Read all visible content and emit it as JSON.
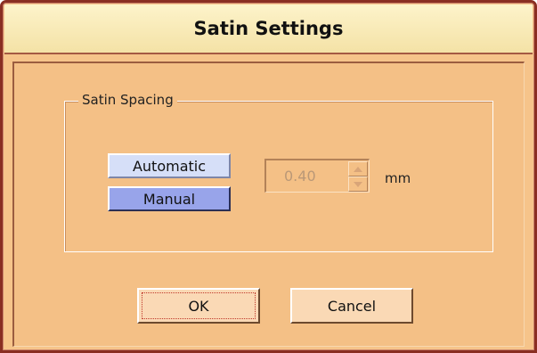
{
  "window": {
    "title": "Satin Settings"
  },
  "group": {
    "label": "Satin Spacing"
  },
  "mode_buttons": {
    "automatic": "Automatic",
    "manual": "Manual",
    "selected": "Manual"
  },
  "spacing": {
    "value": "0.40",
    "unit": "mm",
    "enabled": false
  },
  "buttons": {
    "ok": "OK",
    "cancel": "Cancel"
  },
  "icons": {
    "spin_up": "arrow-up-icon",
    "spin_down": "arrow-down-icon"
  },
  "colors": {
    "dialog_background": "#F6C48A",
    "title_bar": "#FDF3CA",
    "frame_border": "#8A2E22",
    "automatic_button": "#D6DFF8",
    "manual_button_selected": "#98A4EA",
    "disabled_text": "#BA9877",
    "focus_outline": "#C0392B"
  }
}
